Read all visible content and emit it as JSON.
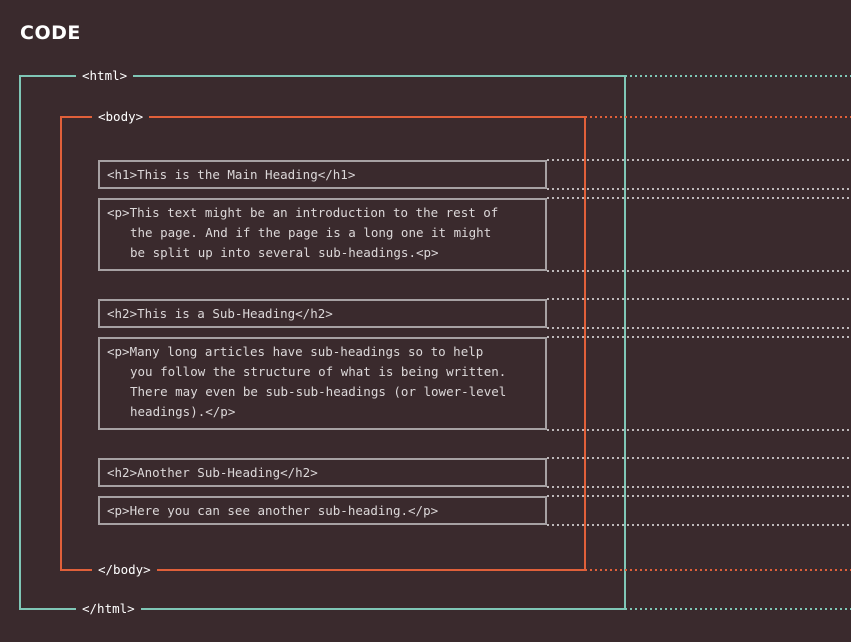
{
  "title": "CODE",
  "colors": {
    "background": "#3a2a2d",
    "html_frame": "#7fc6b6",
    "body_frame": "#e0603a",
    "element_box": "#a6a1a3",
    "text": "#dcd8d9"
  },
  "tags": {
    "html_open": "<html>",
    "html_close": "</html>",
    "body_open": "<body>",
    "body_close": "</body>"
  },
  "elements": [
    {
      "id": "h1",
      "lines": [
        "<h1>This is the Main Heading</h1>"
      ]
    },
    {
      "id": "p1",
      "lines": [
        "<p>This text might be an introduction to the rest of",
        "the page. And if the page is a long one it might",
        "be split up into several sub-headings.<p>"
      ]
    },
    {
      "id": "h2a",
      "lines": [
        "<h2>This is a Sub-Heading</h2>"
      ]
    },
    {
      "id": "p2",
      "lines": [
        "<p>Many long articles have sub-headings so to help",
        "you follow the structure of what is being written.",
        "There may even be sub-sub-headings (or lower-level",
        "headings).</p>"
      ]
    },
    {
      "id": "h2b",
      "lines": [
        "<h2>Another Sub-Heading</h2>"
      ]
    },
    {
      "id": "p3",
      "lines": [
        "<p>Here you can see another sub-heading.</p>"
      ]
    }
  ]
}
